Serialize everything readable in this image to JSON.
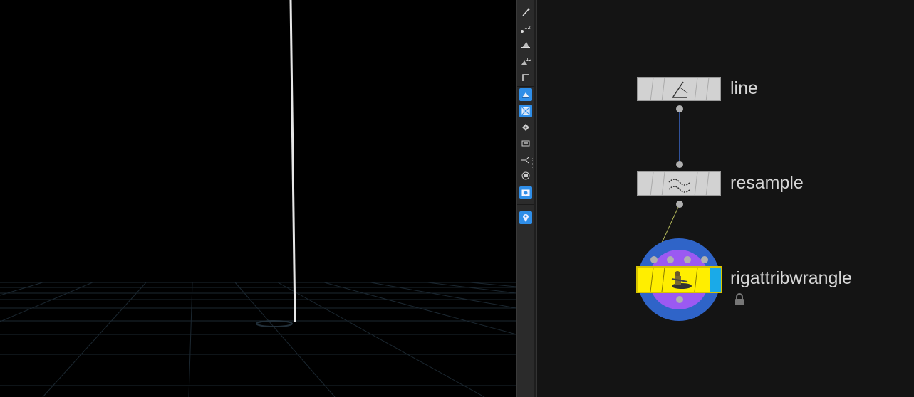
{
  "viewport": {
    "background": "#000000",
    "grid_color": "#1e2a33"
  },
  "toolbar": {
    "tools": [
      {
        "icon": "select-brush-icon",
        "active": false
      },
      {
        "icon": "point-numbers-icon",
        "text": "12",
        "active": false
      },
      {
        "icon": "primitive-shade-icon",
        "active": false
      },
      {
        "icon": "primitive-numbers-icon",
        "text": "12",
        "active": false
      },
      {
        "icon": "corner-frame-icon",
        "active": false
      },
      {
        "icon": "shaded-mode-icon",
        "active": true
      },
      {
        "icon": "wireframe-grid-icon",
        "active": true
      },
      {
        "icon": "template-diamond-icon",
        "active": false
      },
      {
        "icon": "background-image-icon",
        "active": false
      },
      {
        "icon": "snap-pivot-icon",
        "active": false
      },
      {
        "icon": "display-circle-icon",
        "active": false
      },
      {
        "icon": "render-camera-icon",
        "active": true
      },
      {
        "icon": "location-pin-icon",
        "active": true
      }
    ]
  },
  "network": {
    "background": "#141414",
    "nodes": [
      {
        "name": "line",
        "icon": "line-ruler-icon",
        "color": "#d2d2d2"
      },
      {
        "name": "resample",
        "icon": "resample-wave-icon",
        "color": "#d2d2d2"
      },
      {
        "name": "rigattribwrangle",
        "icon": "wrangle-character-icon",
        "color": "#ffee00",
        "flag_color": "#1aaae8",
        "locked": true
      }
    ],
    "wire_color_1": "#3b66c6",
    "wire_color_2": "#b3b85a"
  }
}
